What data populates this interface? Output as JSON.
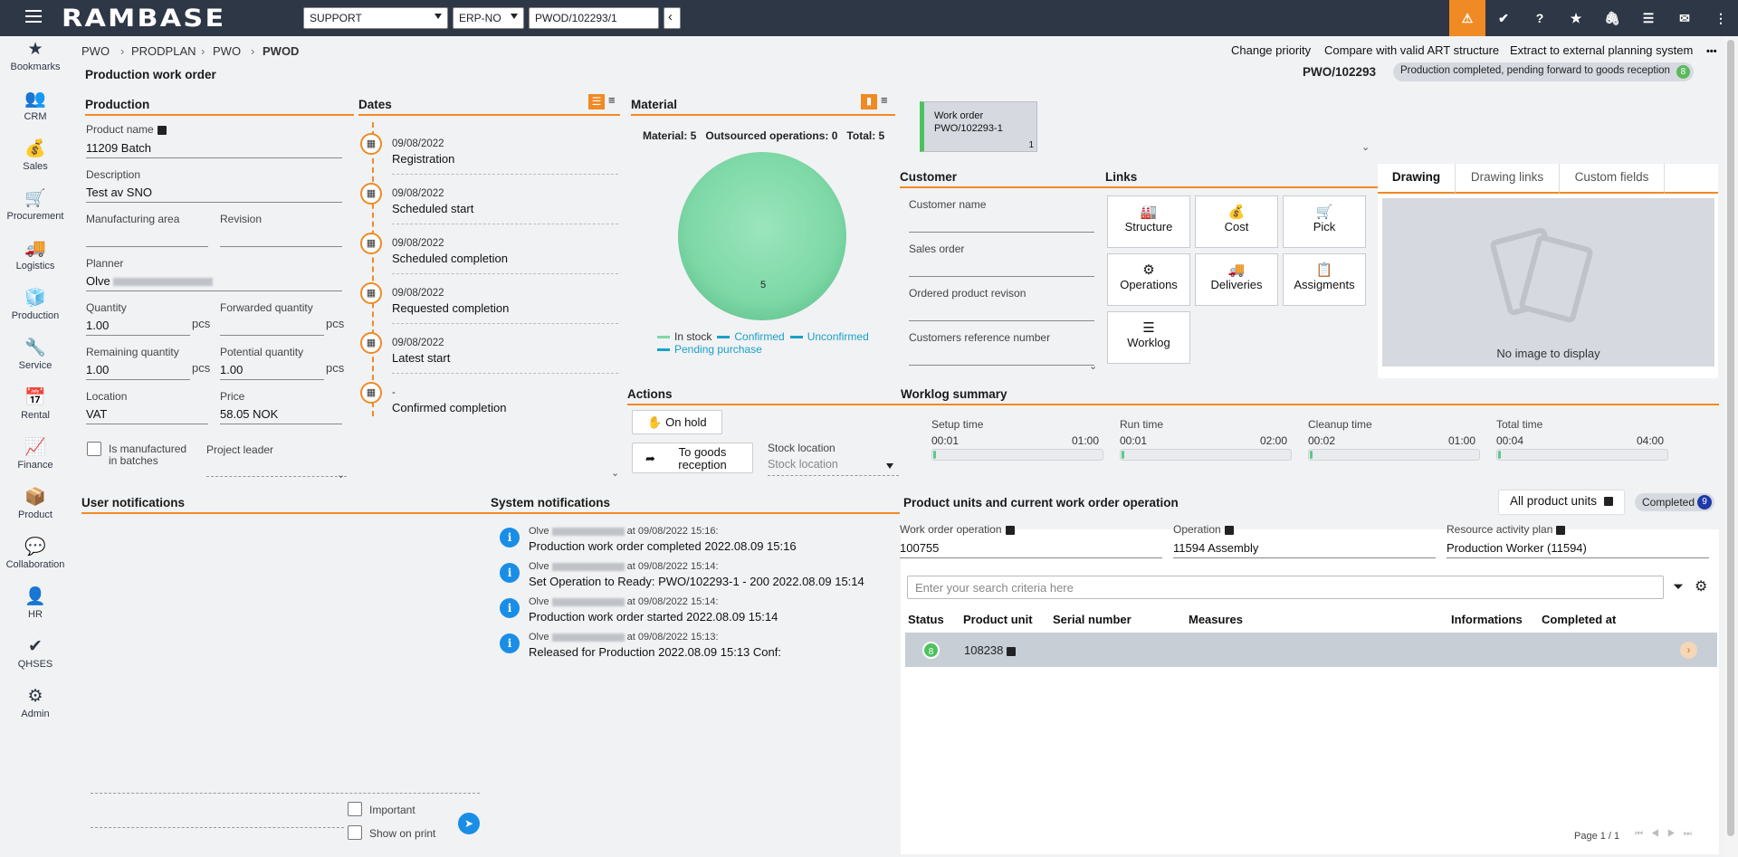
{
  "topbar": {
    "logo": "RAMBASE",
    "company": "SUPPORT",
    "system": "ERP-NO",
    "document": "PWOD/102293/1",
    "back": "‹",
    "icons": [
      "warning-icon",
      "check-shield-icon",
      "help-icon",
      "star-icon",
      "paperclip-icon",
      "list-icon",
      "mail-icon"
    ],
    "accent": "#f08a24"
  },
  "sidebar": [
    {
      "icon": "★",
      "label": "Bookmarks"
    },
    {
      "icon": "👥",
      "label": "CRM"
    },
    {
      "icon": "💰",
      "label": "Sales"
    },
    {
      "icon": "🛒",
      "label": "Procurement"
    },
    {
      "icon": "🚚",
      "label": "Logistics"
    },
    {
      "icon": "🧊",
      "label": "Production"
    },
    {
      "icon": "🔧",
      "label": "Service"
    },
    {
      "icon": "📅",
      "label": "Rental"
    },
    {
      "icon": "📈",
      "label": "Finance"
    },
    {
      "icon": "📦",
      "label": "Product"
    },
    {
      "icon": "💬",
      "label": "Collaboration"
    },
    {
      "icon": "👤",
      "label": "HR"
    },
    {
      "icon": "✔",
      "label": "QHSES"
    },
    {
      "icon": "⚙",
      "label": "Admin"
    }
  ],
  "breadcrumb": [
    "PWO",
    "PRODPLAN",
    "PWO",
    "PWOD"
  ],
  "crumb_sep": "›",
  "toplinks": {
    "change_priority": "Change priority",
    "compare": "Compare with valid ART structure",
    "extract": "Extract to external planning system",
    "more": "•••"
  },
  "header": {
    "title": "Production work order",
    "doc_id": "PWO/102293",
    "status_text": "Production completed, pending forward to goods reception",
    "status_code": "8"
  },
  "production": {
    "heading": "Production",
    "product_name_label": "Product name",
    "product_name": "11209 Batch",
    "description_label": "Description",
    "description": "Test av SNO",
    "area_label": "Manufacturing area",
    "revision_label": "Revision",
    "planner_label": "Planner",
    "planner": "Olve",
    "quantity_label": "Quantity",
    "quantity": "1.00",
    "unit": "pcs",
    "forwarded_label": "Forwarded quantity",
    "remaining_label": "Remaining quantity",
    "remaining": "1.00",
    "potential_label": "Potential quantity",
    "potential": "1.00",
    "location_label": "Location",
    "location": "VAT",
    "price_label": "Price",
    "price": "58.05 NOK",
    "batches_label_1": "Is manufactured",
    "batches_label_2": "in batches",
    "project_leader_label": "Project leader"
  },
  "dates": {
    "heading": "Dates",
    "items": [
      {
        "date": "09/08/2022",
        "name": "Registration"
      },
      {
        "date": "09/08/2022",
        "name": "Scheduled start"
      },
      {
        "date": "09/08/2022",
        "name": "Scheduled completion"
      },
      {
        "date": "09/08/2022",
        "name": "Requested completion"
      },
      {
        "date": "09/08/2022",
        "name": "Latest start"
      },
      {
        "date": "-",
        "name": "Confirmed completion"
      }
    ]
  },
  "material": {
    "heading": "Material",
    "summary_material": "Material: 5",
    "summary_outsourced": "Outsourced operations: 0",
    "summary_total": "Total: 5",
    "pie_value": "5",
    "legend": [
      {
        "name": "In stock",
        "color": "#7fd8a8"
      },
      {
        "name": "Confirmed",
        "color": "#1aa0c8"
      },
      {
        "name": "Unconfirmed",
        "color": "#1aa0c8"
      },
      {
        "name": "Pending purchase",
        "color": "#1aa0c8"
      }
    ]
  },
  "chart_data": {
    "type": "pie",
    "slices": [
      {
        "label": "In stock",
        "value": 5
      }
    ],
    "legend": [
      "In stock",
      "Confirmed",
      "Unconfirmed",
      "Pending purchase"
    ]
  },
  "workorder_card": {
    "title": "Work order",
    "id": "PWO/102293-1",
    "count": "1"
  },
  "customer": {
    "heading": "Customer",
    "name_label": "Customer name",
    "order_label": "Sales order",
    "revision_label": "Ordered product revison",
    "ref_label": "Customers reference number"
  },
  "links": {
    "heading": "Links",
    "items": [
      {
        "icon": "🏭",
        "label": "Structure"
      },
      {
        "icon": "💰",
        "label": "Cost"
      },
      {
        "icon": "🛒",
        "label": "Pick"
      },
      {
        "icon": "⚙",
        "label": "Operations"
      },
      {
        "icon": "🚚",
        "label": "Deliveries"
      },
      {
        "icon": "📋",
        "label": "Assigments"
      },
      {
        "icon": "☰",
        "label": "Worklog"
      }
    ]
  },
  "drawing": {
    "tabs": [
      "Drawing",
      "Drawing links",
      "Custom fields"
    ],
    "empty": "No image to display"
  },
  "actions": {
    "heading": "Actions",
    "on_hold": "On hold",
    "to_goods_1": "To goods",
    "to_goods_2": "reception",
    "stock_location_label": "Stock location",
    "stock_location_placeholder": "Stock location"
  },
  "worklog": {
    "heading": "Worklog summary",
    "items": [
      {
        "label": "Setup time",
        "actual": "00:01",
        "planned": "01:00"
      },
      {
        "label": "Run time",
        "actual": "00:01",
        "planned": "02:00"
      },
      {
        "label": "Cleanup time",
        "actual": "00:02",
        "planned": "01:00"
      },
      {
        "label": "Total time",
        "actual": "00:04",
        "planned": "04:00"
      }
    ]
  },
  "user_notifications": {
    "heading": "User notifications",
    "important": "Important",
    "show_on_print": "Show on print"
  },
  "system_notifications": {
    "heading": "System notifications",
    "items": [
      {
        "who": "Olve",
        "at": "at 09/08/2022 15:16:",
        "text": "Production work order completed  2022.08.09 15:16"
      },
      {
        "who": "Olve",
        "at": "at 09/08/2022 15:14:",
        "text": "Set Operation to Ready: PWO/102293-1 - 200 2022.08.09 15:14"
      },
      {
        "who": "Olve",
        "at": "at 09/08/2022 15:14:",
        "text": "Production work order started 2022.08.09 15:14"
      },
      {
        "who": "Olve",
        "at": "at 09/08/2022 15:13:",
        "text": "Released for Production 2022.08.09 15:13 Conf:"
      }
    ]
  },
  "product_units": {
    "heading": "Product units and current work order operation",
    "all_units": "All product units",
    "completed": "Completed",
    "completed_count": "9",
    "wo_op_label": "Work order operation",
    "wo_op": "100755",
    "operation_label": "Operation",
    "operation": "11594 Assembly",
    "resource_label": "Resource activity plan",
    "resource": "Production Worker (11594)",
    "search_placeholder": "Enter your search criteria here",
    "columns": [
      "Status",
      "Product unit",
      "Serial number",
      "Measures",
      "Informations",
      "Completed at"
    ],
    "rows": [
      {
        "status": "8",
        "unit": "108238"
      }
    ],
    "pager": "Page 1 / 1"
  }
}
